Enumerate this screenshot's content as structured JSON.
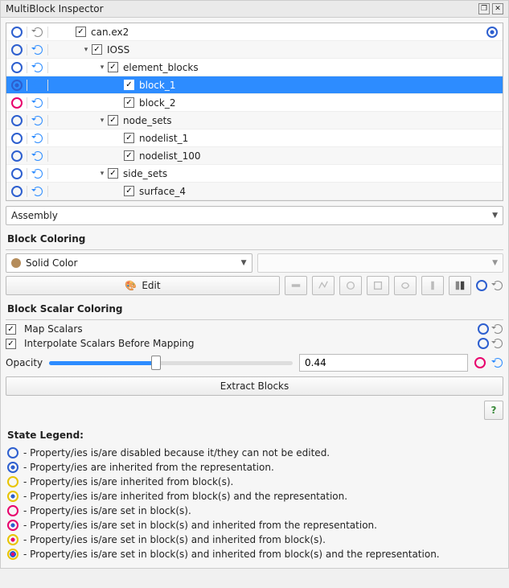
{
  "window": {
    "title": "MultiBlock Inspector"
  },
  "tree": {
    "rows": [
      {
        "indent": 0,
        "expander": "",
        "checked": true,
        "label": "can.ex2",
        "state": "sc-disabled",
        "reset": "off",
        "end_icon": true
      },
      {
        "indent": 1,
        "expander": "▾",
        "checked": true,
        "label": "IOSS",
        "state": "sc-disabled",
        "reset": "on",
        "alt": true
      },
      {
        "indent": 2,
        "expander": "▾",
        "checked": true,
        "label": "element_blocks",
        "state": "sc-disabled",
        "reset": "on"
      },
      {
        "indent": 3,
        "expander": "",
        "checked": true,
        "label": "block_1",
        "state": "sc-inherit-rep",
        "reset": "on",
        "selected": true
      },
      {
        "indent": 3,
        "expander": "",
        "checked": true,
        "label": "block_2",
        "state": "sc-set-blk",
        "reset": "on"
      },
      {
        "indent": 2,
        "expander": "▾",
        "checked": true,
        "label": "node_sets",
        "state": "sc-disabled",
        "reset": "on",
        "alt": true
      },
      {
        "indent": 3,
        "expander": "",
        "checked": true,
        "label": "nodelist_1",
        "state": "sc-disabled",
        "reset": "on"
      },
      {
        "indent": 3,
        "expander": "",
        "checked": true,
        "label": "nodelist_100",
        "state": "sc-disabled",
        "reset": "on",
        "alt": true
      },
      {
        "indent": 2,
        "expander": "▾",
        "checked": true,
        "label": "side_sets",
        "state": "sc-disabled",
        "reset": "on"
      },
      {
        "indent": 3,
        "expander": "",
        "checked": true,
        "label": "surface_4",
        "state": "sc-disabled",
        "reset": "on",
        "alt": true
      }
    ]
  },
  "assembly_combo": "Assembly",
  "sections": {
    "block_coloring": "Block Coloring",
    "block_scalar_coloring": "Block Scalar Coloring",
    "state_legend": "State Legend:"
  },
  "color_combo": "Solid Color",
  "edit_button": "Edit",
  "map_scalars": "Map Scalars",
  "interpolate_scalars": "Interpolate Scalars Before Mapping",
  "opacity": {
    "label": "Opacity",
    "value": "0.44",
    "fraction": 0.44
  },
  "extract_button": "Extract Blocks",
  "legend": [
    {
      "class": "sc-disabled",
      "text": "- Property/ies is/are disabled because it/they can not be edited."
    },
    {
      "class": "sc-inherit-rep",
      "text": "- Property/ies are inherited from the representation."
    },
    {
      "class": "sc-inherit-blk",
      "text": "- Property/ies is/are inherited from block(s)."
    },
    {
      "class": "sc-inherit-blk-rep",
      "text": "- Property/ies is/are inherited from block(s) and the representation."
    },
    {
      "class": "sc-set-blk",
      "text": "- Property/ies is/are set in block(s)."
    },
    {
      "class": "sc-set-blk-rep",
      "text": "- Property/ies is/are set in block(s) and inherited from the representation."
    },
    {
      "class": "sc-set-inh-blk",
      "text": "- Property/ies is/are set in block(s) and inherited from block(s)."
    },
    {
      "class": "sc-set-inh-blk-rep",
      "text": "- Property/ies is/are set in block(s) and inherited from block(s) and the representation."
    }
  ]
}
